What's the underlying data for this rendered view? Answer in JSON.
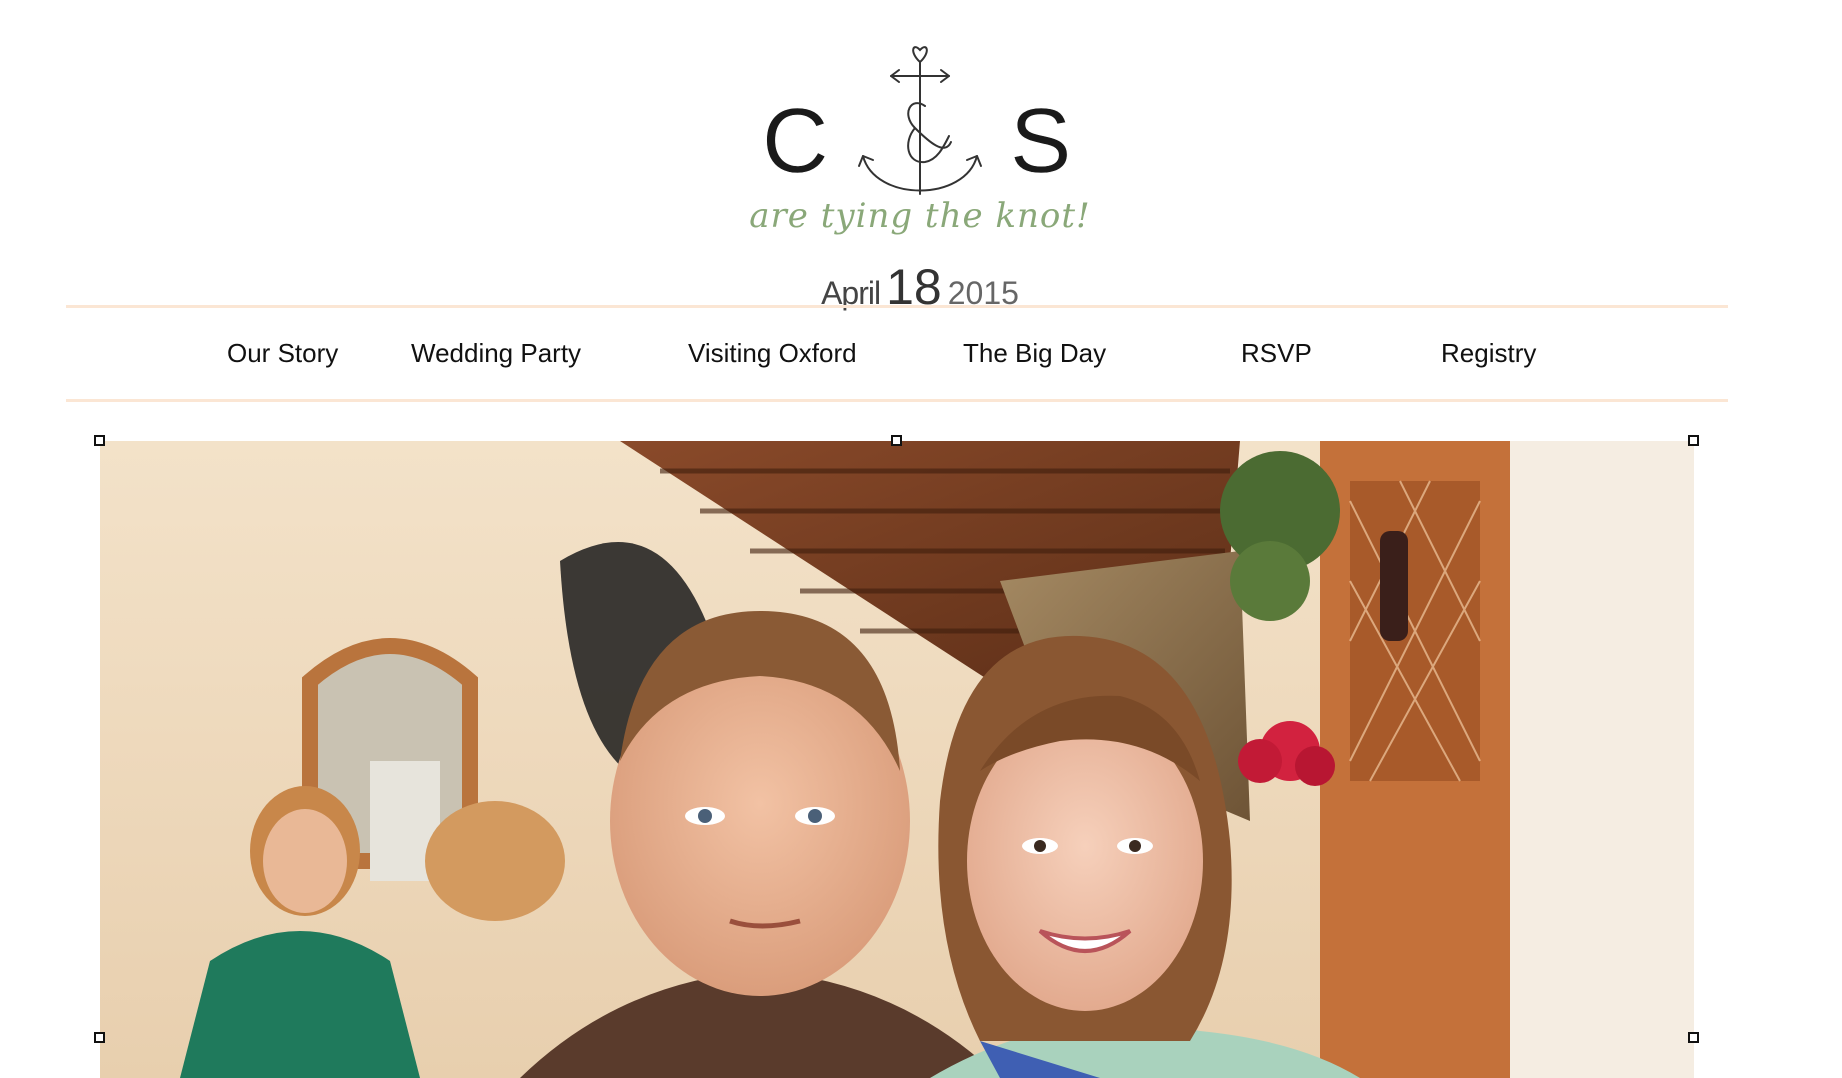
{
  "logo": {
    "left_letter": "C",
    "right_letter": "S",
    "tagline": "are tying the knot!",
    "date_month": "April",
    "date_day": "18",
    "date_year": "2015",
    "icon": "anchor-ampersand-heart-icon",
    "tagline_color": "#8aa879"
  },
  "nav": {
    "items": [
      {
        "label": "Our Story"
      },
      {
        "label": "Wedding Party"
      },
      {
        "label": "Visiting Oxford"
      },
      {
        "label": "The Big Day"
      },
      {
        "label": "RSVP"
      },
      {
        "label": "Registry"
      }
    ],
    "rule_color": "#fbe6d4"
  },
  "photo": {
    "subject": "couple-photo",
    "selected": true
  }
}
